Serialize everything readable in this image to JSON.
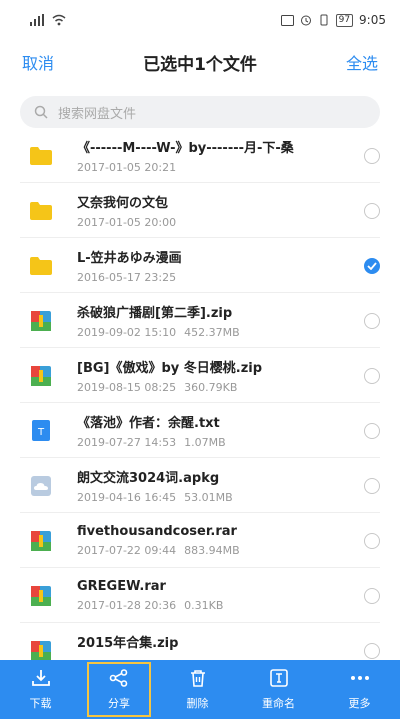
{
  "status": {
    "time": "9:05",
    "battery": "97"
  },
  "header": {
    "cancel": "取消",
    "title": "已选中1个文件",
    "select_all": "全选"
  },
  "search": {
    "placeholder": "搜索网盘文件"
  },
  "colors": {
    "accent": "#2d8cf0",
    "folder": "#f5c518",
    "highlight": "#f5c542"
  },
  "files": [
    {
      "name": "《------M----W-》by-------月-下-桑",
      "date": "2017-01-05 20:21",
      "size": "",
      "icon": "folder-icon",
      "checked": false
    },
    {
      "name": "又奈我何の文包",
      "date": "2017-01-05 20:00",
      "size": "",
      "icon": "folder-icon",
      "checked": false
    },
    {
      "name": "L-笠井あゆみ漫画",
      "date": "2016-05-17 23:25",
      "size": "",
      "icon": "folder-icon",
      "checked": true
    },
    {
      "name": "杀破狼广播剧[第二季].zip",
      "date": "2019-09-02 15:10",
      "size": "452.37MB",
      "icon": "archive-icon",
      "checked": false
    },
    {
      "name": "[BG]《傲戏》by 冬日樱桃.zip",
      "date": "2019-08-15 08:25",
      "size": "360.79KB",
      "icon": "archive-icon",
      "checked": false
    },
    {
      "name": "《落池》作者：余醒.txt",
      "date": "2019-07-27 14:53",
      "size": "1.07MB",
      "icon": "text-file-icon",
      "checked": false
    },
    {
      "name": "朗文交流3024词.apkg",
      "date": "2019-04-16 16:45",
      "size": "53.01MB",
      "icon": "cloud-file-icon",
      "checked": false
    },
    {
      "name": "fivethousandcoser.rar",
      "date": "2017-07-22 09:44",
      "size": "883.94MB",
      "icon": "archive-icon",
      "checked": false
    },
    {
      "name": "GREGEW.rar",
      "date": "2017-01-28 20:36",
      "size": "0.31KB",
      "icon": "archive-icon",
      "checked": false
    },
    {
      "name": "2015年合集.zip",
      "date": "",
      "size": "",
      "icon": "archive-icon",
      "checked": false
    }
  ],
  "toolbar": [
    {
      "label": "下载",
      "icon": "download-icon"
    },
    {
      "label": "分享",
      "icon": "share-icon"
    },
    {
      "label": "删除",
      "icon": "trash-icon"
    },
    {
      "label": "重命名",
      "icon": "rename-icon"
    },
    {
      "label": "更多",
      "icon": "more-icon"
    }
  ]
}
